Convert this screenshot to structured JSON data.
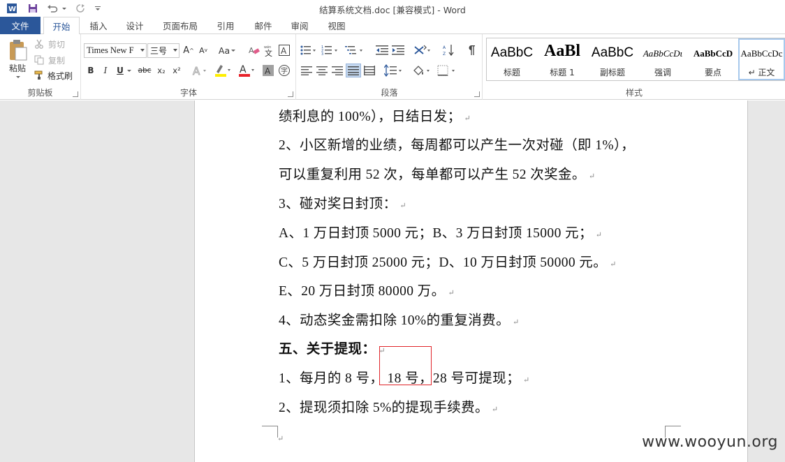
{
  "window": {
    "title": "结算系统文档.doc [兼容模式] - Word"
  },
  "tabs": {
    "file": "文件",
    "items": [
      "开始",
      "插入",
      "设计",
      "页面布局",
      "引用",
      "邮件",
      "审阅",
      "视图"
    ],
    "active": "开始"
  },
  "ribbon": {
    "clipboard": {
      "paste": "粘贴",
      "cut": "剪切",
      "copy": "复制",
      "format_painter": "格式刷",
      "label": "剪贴板"
    },
    "font": {
      "font_name": "Times New F",
      "font_size": "三号",
      "change_case": "Aa",
      "bold": "B",
      "italic": "I",
      "underline": "U",
      "strikethrough": "abc",
      "subscript": "x₂",
      "superscript": "x²",
      "label": "字体"
    },
    "paragraph": {
      "label": "段落"
    },
    "styles": {
      "items": [
        {
          "sample": "AaBbC",
          "name": "标题"
        },
        {
          "sample": "AaBl",
          "name": "标题 1"
        },
        {
          "sample": "AaBbC",
          "name": "副标题"
        },
        {
          "sample": "AaBbCcDι",
          "name": "强调"
        },
        {
          "sample": "AaBbCcD",
          "name": "要点"
        },
        {
          "sample": "AaBbCcDc",
          "name": "↵ 正文"
        }
      ],
      "label": "样式"
    }
  },
  "document": {
    "lines": [
      {
        "text": "绩利息的 100%），日结日发；",
        "bold": false
      },
      {
        "text": "2、小区新增的业绩，每周都可以产生一次对碰（即  1%），",
        "bold": false
      },
      {
        "text": "可以重复利用 52 次，每单都可以产生 52 次奖金。",
        "bold": false
      },
      {
        "text": "3、碰对奖日封顶：",
        "bold": false
      },
      {
        "text": "A、1 万日封顶 5000 元；B、3 万日封顶 15000 元；",
        "bold": false
      },
      {
        "text": "C、5 万日封顶 25000 元；D、10 万日封顶 50000 元。",
        "bold": false
      },
      {
        "text": "E、20 万日封顶 80000 万。",
        "bold": false
      },
      {
        "text": "4、动态奖金需扣除 10%的重复消费。",
        "bold": false
      },
      {
        "text": "五、关于提现：",
        "bold": true
      },
      {
        "text": "1、每月的 8 号， 18 号，28 号可提现；",
        "bold": false
      },
      {
        "text": "2、提现须扣除 5%的提现手续费。",
        "bold": false
      }
    ],
    "paragraph_mark": "↵"
  },
  "watermark": "www.wooyun.org",
  "colors": {
    "accent": "#2b579a",
    "highlight_box": "#e0252a"
  }
}
